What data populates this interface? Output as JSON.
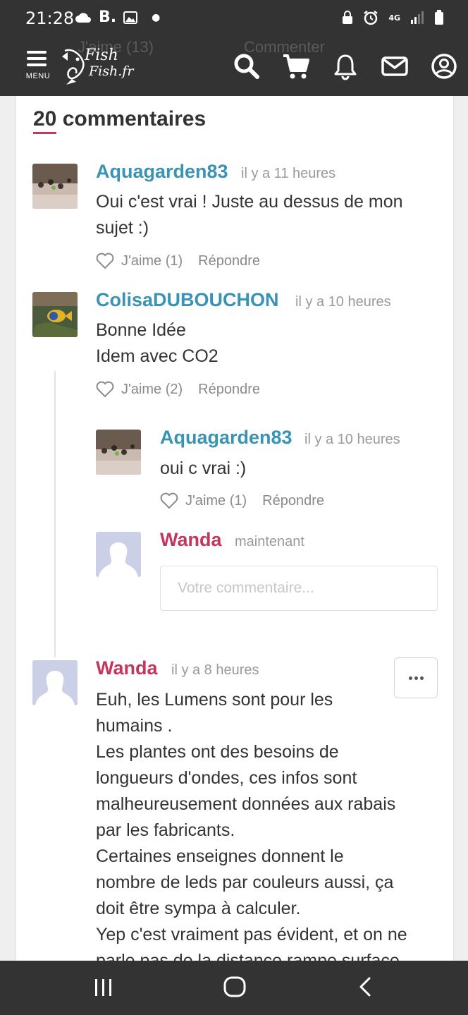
{
  "status_bar": {
    "time": "21:28",
    "carrier_letter": "B.",
    "network": "4G"
  },
  "navbar": {
    "menu_label": "MENU",
    "logo_line1": "Fish",
    "logo_line2": "Fish.fr",
    "ghost_like": "J'aime (13)",
    "ghost_comment": "Commenter"
  },
  "comments_header": {
    "count": "20",
    "label": "commentaires"
  },
  "comments": [
    {
      "author": "Aquagarden83",
      "time": "il y a 11 heures",
      "text": "Oui c'est vrai ! Juste au dessus de mon\nsujet :)",
      "like": "J'aime (1)",
      "reply": "Répondre"
    },
    {
      "author": "ColisaDUBOUCHON",
      "time": "il y a 10 heures",
      "text": "Bonne Idée\nIdem avec CO2",
      "like": "J'aime (2)",
      "reply": "Répondre"
    }
  ],
  "reply": {
    "author": "Aquagarden83",
    "time": "il y a 10 heures",
    "text": "oui c vrai :)",
    "like": "J'aime (1)",
    "reply": "Répondre"
  },
  "composer": {
    "author": "Wanda",
    "time": "maintenant",
    "placeholder": "Votre commentaire..."
  },
  "wanda_comment": {
    "author": "Wanda",
    "time": "il y a 8 heures",
    "text": "Euh, les Lumens sont pour les\nhumains .\nLes plantes ont des besoins de\nlongueurs d'ondes, ces infos sont\nmalheureusement données aux rabais\npar les fabricants.\nCertaines enseignes donnent le\nnombre de leds par couleurs aussi, ça\ndoit être sympa à calculer.\nYep c'est vraiment pas évident, et on ne\nparle pas de la distance rampe surface"
  },
  "colors": {
    "brand_dark": "#333333",
    "author_blue": "#3a93b5",
    "author_pink": "#c3375f"
  }
}
